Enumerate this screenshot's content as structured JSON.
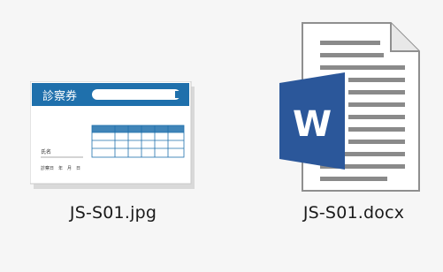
{
  "files": [
    {
      "name": "JS-S01.jpg",
      "icon": "image-thumbnail-icon",
      "thumbnail_title": "診察券",
      "thumbnail_label_name": "氏名",
      "thumbnail_label_date": "診察日　年　月　日"
    },
    {
      "name": "JS-S01.docx",
      "icon": "word-document-icon",
      "badge_letter": "W"
    }
  ],
  "colors": {
    "background": "#f6f6f6",
    "jpg_header": "#1f70ac",
    "word_blue": "#2b579a",
    "text": "#1a1a1a"
  }
}
